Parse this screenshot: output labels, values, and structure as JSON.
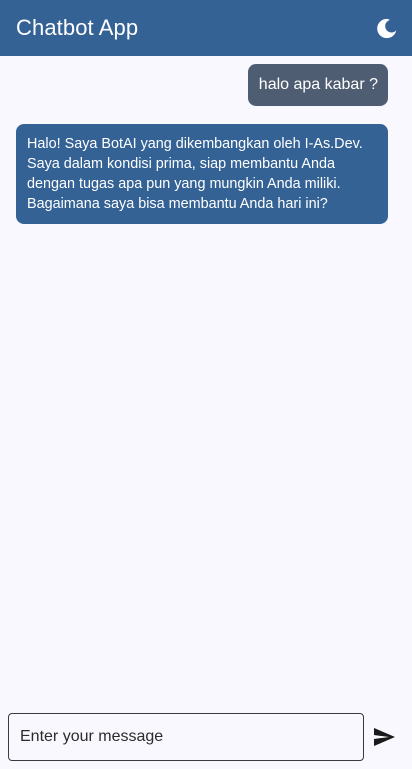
{
  "appbar": {
    "title": "Chatbot App",
    "theme_icon": "moon-icon"
  },
  "messages": [
    {
      "sender": "user",
      "text": "halo apa kabar ?"
    },
    {
      "sender": "bot",
      "text": "Halo! Saya BotAI yang dikembangkan oleh I-As.Dev. Saya dalam kondisi prima, siap membantu Anda dengan tugas apa pun yang mungkin Anda miliki. Bagaimana saya bisa membantu Anda hari ini?"
    }
  ],
  "composer": {
    "placeholder": "Enter your message",
    "value": "",
    "send_icon": "send-icon"
  },
  "colors": {
    "appbar": "#346295",
    "user_bubble": "#4f5d72",
    "bot_bubble": "#346295",
    "background": "#f8f8fe"
  }
}
